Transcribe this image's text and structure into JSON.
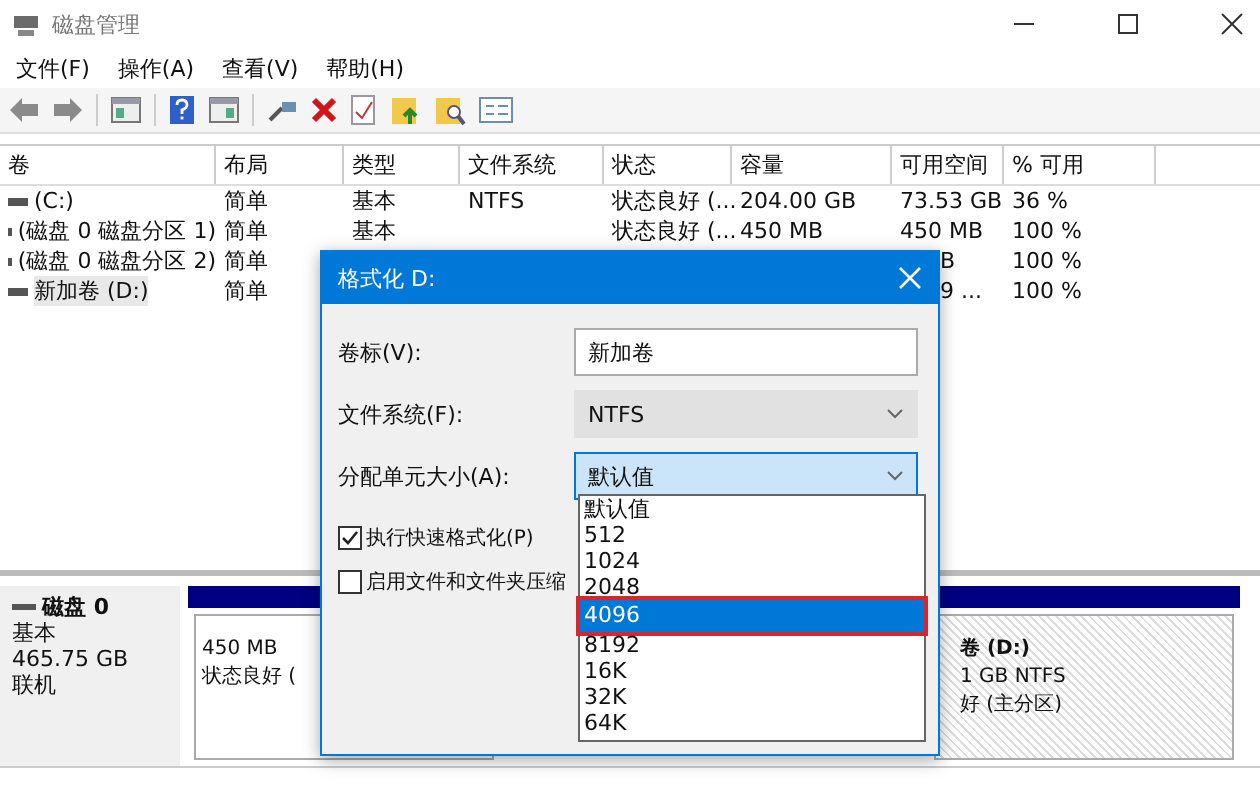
{
  "window": {
    "title": "磁盘管理"
  },
  "menu": [
    "文件(F)",
    "操作(A)",
    "查看(V)",
    "帮助(H)"
  ],
  "table": {
    "columns": [
      "卷",
      "布局",
      "类型",
      "文件系统",
      "状态",
      "容量",
      "可用空间",
      "% 可用"
    ],
    "rows": [
      {
        "selected": false,
        "clipped": false,
        "cells": [
          "(C:)",
          "简单",
          "基本",
          "NTFS",
          "状态良好 (...",
          "204.00 GB",
          "73.53 GB",
          "36 %"
        ]
      },
      {
        "selected": false,
        "clipped": false,
        "cells": [
          "(磁盘 0 磁盘分区 1)",
          "简单",
          "基本",
          "",
          "状态良好 (...",
          "450 MB",
          "450 MB",
          "100 %"
        ]
      },
      {
        "selected": false,
        "clipped": true,
        "cells": [
          "(磁盘 0 磁盘分区 2)",
          "简单",
          "",
          "",
          "",
          "",
          "B",
          "100 %"
        ]
      },
      {
        "selected": true,
        "clipped": true,
        "cells": [
          "新加卷 (D:)",
          "简单",
          "",
          "",
          "",
          "",
          "9 ...",
          "100 %"
        ]
      }
    ]
  },
  "disk": {
    "name": "磁盘 0",
    "type": "基本",
    "size": "465.75 GB",
    "status": "联机",
    "partitions": [
      {
        "selected": false,
        "lines": [
          "450 MB",
          "状态良好 ("
        ]
      },
      {
        "selected": true,
        "lines": [
          "卷 (D:)",
          "1 GB NTFS",
          "好 (主分区)"
        ]
      }
    ]
  },
  "dialog": {
    "title": "格式化 D:",
    "fields": [
      {
        "kind": "text",
        "label": "卷标(V):",
        "value": "新加卷"
      },
      {
        "kind": "select",
        "label": "文件系统(F):",
        "value": "NTFS",
        "open": false
      },
      {
        "kind": "select",
        "label": "分配单元大小(A):",
        "value": "默认值",
        "open": true
      }
    ],
    "checkboxes": [
      {
        "label": "执行快速格式化(P)",
        "checked": true
      },
      {
        "label": "启用文件和文件夹压缩",
        "checked": false
      }
    ],
    "dropdown": [
      {
        "text": "默认值",
        "selected": false
      },
      {
        "text": "512",
        "selected": false
      },
      {
        "text": "1024",
        "selected": false
      },
      {
        "text": "2048",
        "selected": false
      },
      {
        "text": "4096",
        "selected": true
      },
      {
        "text": "8192",
        "selected": false
      },
      {
        "text": "16K",
        "selected": false
      },
      {
        "text": "32K",
        "selected": false
      },
      {
        "text": "64K",
        "selected": false
      }
    ]
  }
}
